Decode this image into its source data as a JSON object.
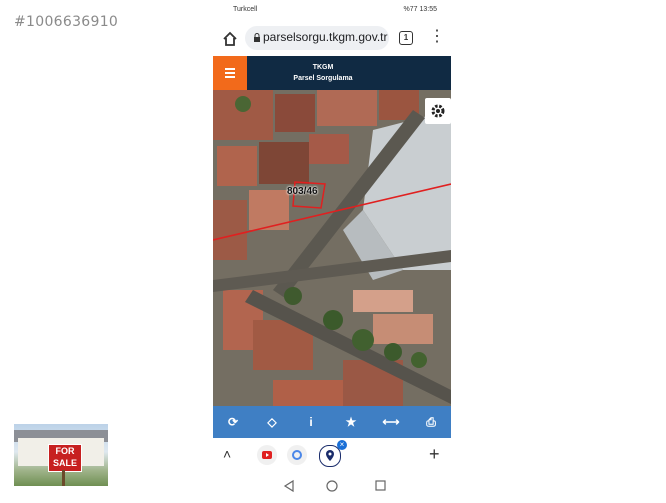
{
  "listing": {
    "id_text": "#1006636910"
  },
  "thumbnail": {
    "sign_text": "FOR SALE"
  },
  "status_bar": {
    "carrier": "Turkcell",
    "right": "%77 13:55"
  },
  "browser": {
    "url": "parselsorgu.tkgm.gov.tr",
    "tab_count": "1"
  },
  "app_header": {
    "title": "TKGM",
    "subtitle": "Parsel Sorgulama"
  },
  "map": {
    "parcel_label": "803/46"
  },
  "toolbar": {
    "items": [
      {
        "name": "refresh-icon",
        "glyph": "⟳"
      },
      {
        "name": "location-icon",
        "glyph": "◇"
      },
      {
        "name": "info-icon",
        "glyph": "i"
      },
      {
        "name": "star-icon",
        "glyph": "★"
      },
      {
        "name": "measure-icon",
        "glyph": "⟷"
      },
      {
        "name": "print-icon",
        "glyph": "⎙"
      }
    ]
  },
  "bottom_bar": {
    "up_glyph": "˄",
    "add_glyph": "+"
  },
  "colors": {
    "header": "#102a43",
    "menu": "#f26a1b",
    "toolbar": "#3f7fc4",
    "parcel_line": "#e02020"
  }
}
